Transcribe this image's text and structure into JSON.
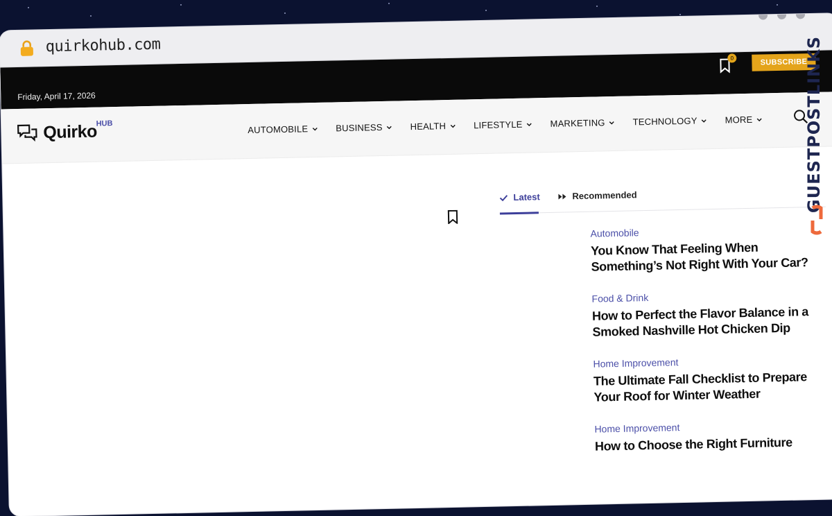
{
  "browser": {
    "url": "quirkohub.com"
  },
  "topbar": {
    "date": "Friday, April 17, 2026",
    "bookmark_count": "0",
    "subscribe_label": "SUBSCRIBE"
  },
  "logo": {
    "name": "Quirko",
    "suffix": "HUB"
  },
  "nav": {
    "items": [
      {
        "label": "AUTOMOBILE"
      },
      {
        "label": "BUSINESS"
      },
      {
        "label": "HEALTH"
      },
      {
        "label": "LIFESTYLE"
      },
      {
        "label": "MARKETING"
      },
      {
        "label": "TECHNOLOGY"
      },
      {
        "label": "MORE"
      }
    ]
  },
  "tabs": {
    "latest": "Latest",
    "recommended": "Recommended"
  },
  "posts": [
    {
      "category": "Automobile",
      "title": "You Know That Feeling When Something’s Not Right With Your Car?"
    },
    {
      "category": "Food & Drink",
      "title": "How to Perfect the Flavor Balance in a Smoked Nashville Hot Chicken Dip"
    },
    {
      "category": "Home Improvement",
      "title": "The Ultimate Fall Checklist to Prepare Your Roof for Winter Weather"
    },
    {
      "category": "Home Improvement",
      "title": "How to Choose the Right Furniture"
    }
  ],
  "watermark": {
    "text": "GUESTPOSTLINKS"
  },
  "colors": {
    "accent": "#4b4fa8",
    "subscribe": "#e4a41b",
    "topbar": "#0a0a0a"
  }
}
